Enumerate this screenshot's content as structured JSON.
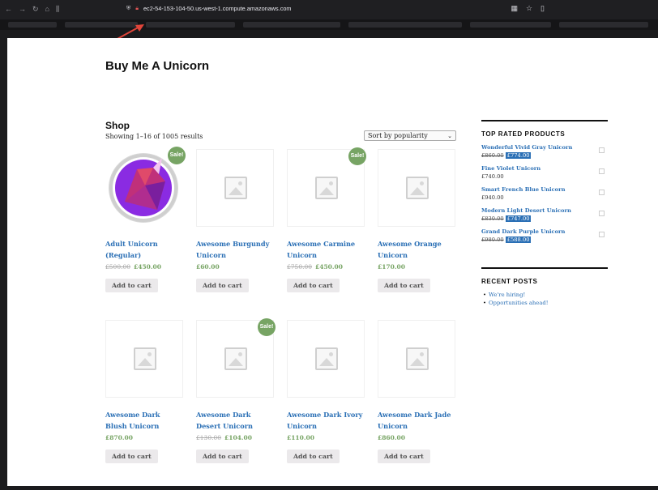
{
  "browser": {
    "url": "ec2-54-153-104-50.us-west-1.compute.amazonaws.com"
  },
  "site": {
    "title": "Buy Me A Unicorn"
  },
  "shop": {
    "title": "Shop",
    "results": "Showing 1–16 of 1005 results",
    "sort_label": "Sort by popularity",
    "add_to_cart_label": "Add to cart",
    "sale_badge": "Sale!",
    "products": [
      {
        "name": "Adult Unicorn (Regular)",
        "old_price": "£500.00",
        "price": "£450.00",
        "sale": true
      },
      {
        "name": "Awesome Burgundy Unicorn",
        "old_price": "",
        "price": "£60.00",
        "sale": false
      },
      {
        "name": "Awesome Carmine Unicorn",
        "old_price": "£750.00",
        "price": "£450.00",
        "sale": true
      },
      {
        "name": "Awesome Orange Unicorn",
        "old_price": "",
        "price": "£170.00",
        "sale": false
      },
      {
        "name": "Awesome Dark Blush Unicorn",
        "old_price": "",
        "price": "£870.00",
        "sale": false
      },
      {
        "name": "Awesome Dark Desert Unicorn",
        "old_price": "£130.00",
        "price": "£104.00",
        "sale": true
      },
      {
        "name": "Awesome Dark Ivory Unicorn",
        "old_price": "",
        "price": "£110.00",
        "sale": false
      },
      {
        "name": "Awesome Dark Jade Unicorn",
        "old_price": "",
        "price": "£860.00",
        "sale": false
      }
    ]
  },
  "sidebar": {
    "top_rated_title": "TOP RATED PRODUCTS",
    "top_rated": [
      {
        "name": "Wonderful Vivid Gray Unicorn",
        "old_price": "£860.00",
        "price": "£774.00"
      },
      {
        "name": "Fine Violet Unicorn",
        "old_price": "",
        "price": "£740.00"
      },
      {
        "name": "Smart French Blue Unicorn",
        "old_price": "",
        "price": "£940.00"
      },
      {
        "name": "Modern Light Desert Unicorn",
        "old_price": "£830.00",
        "price": "£747.00"
      },
      {
        "name": "Grand Dark Purple Unicorn",
        "old_price": "£980.00",
        "price": "£588.00"
      }
    ],
    "recent_posts_title": "RECENT POSTS",
    "recent_posts": [
      "We're hiring!",
      "Opportunities ahead!"
    ]
  },
  "colors": {
    "link": "#2a6fb5",
    "sale": "#77a464",
    "annotation_arrow": "#e0453a"
  },
  "icons": [
    "back-icon",
    "forward-icon",
    "reload-icon",
    "home-icon",
    "library-icon",
    "shield-icon",
    "lock-icon",
    "extensions-icon",
    "star-icon",
    "reader-icon",
    "image-placeholder-icon"
  ]
}
